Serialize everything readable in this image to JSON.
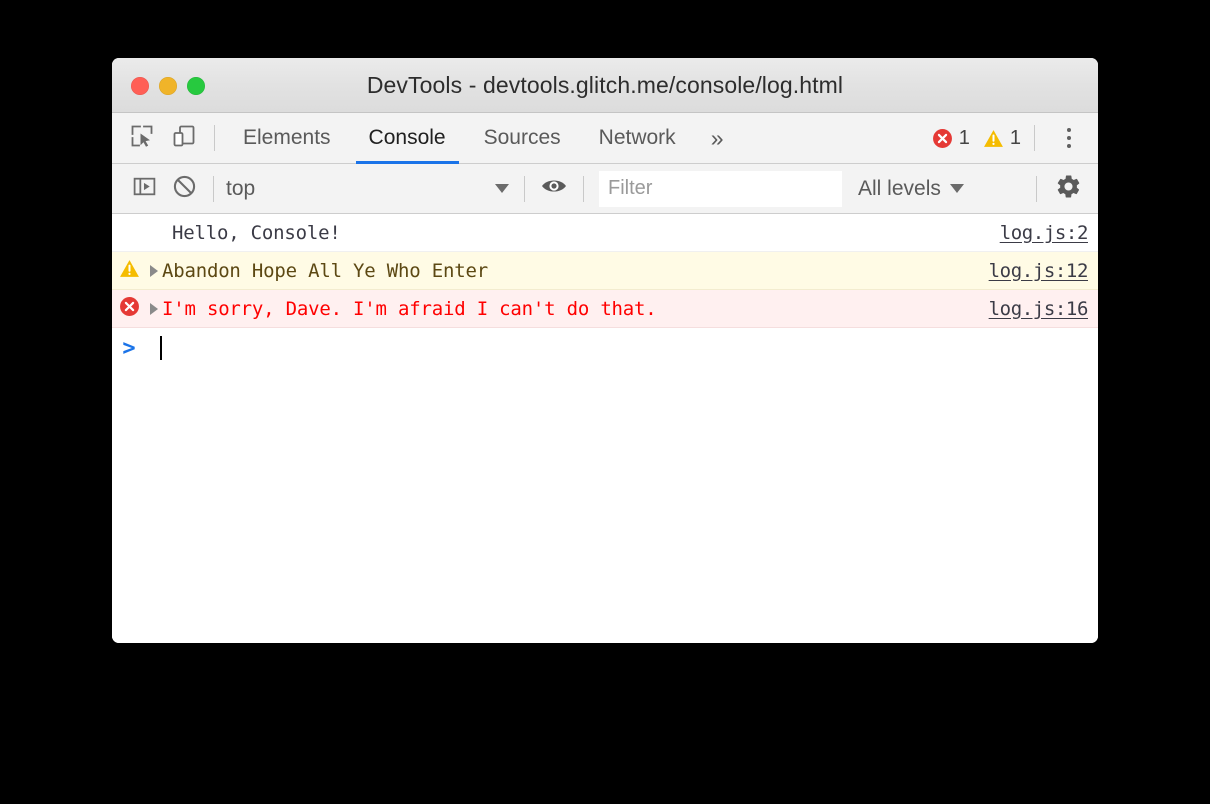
{
  "window": {
    "title": "DevTools - devtools.glitch.me/console/log.html",
    "traffic_lights": [
      {
        "name": "close",
        "color": "#ff5f56"
      },
      {
        "name": "minimize",
        "color": "#f0b429"
      },
      {
        "name": "zoom",
        "color": "#27c93f"
      }
    ]
  },
  "tabbar": {
    "inspect_icon": "inspect-element-icon",
    "device_icon": "device-toolbar-icon",
    "tabs": [
      {
        "label": "Elements",
        "active": false
      },
      {
        "label": "Console",
        "active": true
      },
      {
        "label": "Sources",
        "active": false
      },
      {
        "label": "Network",
        "active": false
      }
    ],
    "overflow_label": "»",
    "error_count": "1",
    "warning_count": "1",
    "menu_icon": "kebab-menu-icon",
    "active_tab_color": "#1a73e8",
    "error_color": "#e53935",
    "warning_color": "#f5bc00"
  },
  "console_toolbar": {
    "sidebar_toggle_icon": "console-sidebar-icon",
    "clear_icon": "clear-console-icon",
    "context_value": "top",
    "eye_icon": "live-expression-eye-icon",
    "filter_placeholder": "Filter",
    "filter_value": "",
    "levels_label": "All levels",
    "settings_icon": "gear-icon"
  },
  "console_messages": [
    {
      "level": "log",
      "icon": "",
      "expandable": false,
      "text": "Hello, Console!",
      "source": "log.js:2"
    },
    {
      "level": "warning",
      "icon": "warning-triangle-icon",
      "expandable": true,
      "text": "Abandon Hope All Ye Who Enter",
      "source": "log.js:12"
    },
    {
      "level": "error",
      "icon": "error-circle-icon",
      "expandable": true,
      "text": "I'm sorry, Dave. I'm afraid I can't do that.",
      "source": "log.js:16"
    }
  ],
  "prompt": {
    "chevron": ">",
    "value": ""
  }
}
